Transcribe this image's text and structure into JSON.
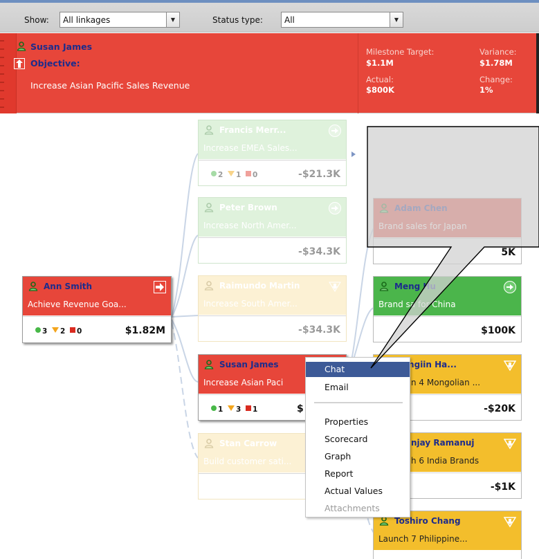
{
  "toolbar": {
    "show_label": "Show:",
    "show_value": "All linkages",
    "status_label": "Status type:",
    "status_value": "All"
  },
  "objective_header": {
    "person": "Susan James",
    "objective_label": "Objective:",
    "objective_text": "Increase Asian Pacific Sales Revenue",
    "metrics": {
      "milestone_label": "Milestone Target:",
      "milestone_value": "$1.1M",
      "variance_label": "Variance:",
      "variance_value": "$1.78M",
      "actual_label": "Actual:",
      "actual_value": "$800K",
      "change_label": "Change:",
      "change_value": "1%"
    }
  },
  "cards": {
    "ann": {
      "name": "Ann Smith",
      "desc": "Achieve Revenue Goa...",
      "green": "3",
      "yellow": "2",
      "red": "0",
      "value": "$1.82M"
    },
    "francis": {
      "name": "Francis Merr...",
      "desc": "Increase EMEA Sales...",
      "green": "2",
      "yellow": "1",
      "red": "0",
      "value": "-$21.3K"
    },
    "peter": {
      "name": "Peter Brown",
      "desc": "Increase North Amer...",
      "value": "-$34.3K"
    },
    "raimundo": {
      "name": "Raimundo Martin",
      "desc": "Increase South Amer...",
      "value": "-$34.3K"
    },
    "susan": {
      "name": "Susan James",
      "desc": "Increase Asian Paci",
      "green": "1",
      "yellow": "3",
      "red": "1",
      "value": "$"
    },
    "stan": {
      "name": "Stan Carrow",
      "desc": "Build customer sati..."
    },
    "adam": {
      "name": "Adam Chen",
      "desc": "Brand sales for Japan",
      "value": "5K"
    },
    "meng": {
      "name": "Meng Hu",
      "desc": "Brand sa   for China",
      "value": "$100K"
    },
    "mongolia": {
      "name": "rengiin Ha...",
      "desc": "n 4 Mongolian ...",
      "value": "-$20K"
    },
    "sanjay": {
      "name": "njay Ramanuj",
      "desc": "h 6 India Brands",
      "value": "-$1K"
    },
    "toshiro": {
      "name": "Toshiro Chang",
      "desc": "Launch 7 Philippine..."
    }
  },
  "context_menu": {
    "items": [
      "Chat",
      "Email",
      "Properties",
      "Scorecard",
      "Graph",
      "Report",
      "Actual Values",
      "Attachments"
    ],
    "highlighted": "Chat",
    "disabled": "Attachments"
  },
  "colors": {
    "red": "#e7463a",
    "green": "#4bb54b",
    "yellow": "#f3be2c",
    "menu_highlight": "#3d5a97",
    "name_blue": "#1d2c8c"
  },
  "icons": [
    "person-icon",
    "up-arrow-icon",
    "right-arrow-icon",
    "down-arrow-icon",
    "chevron-down-icon"
  ]
}
